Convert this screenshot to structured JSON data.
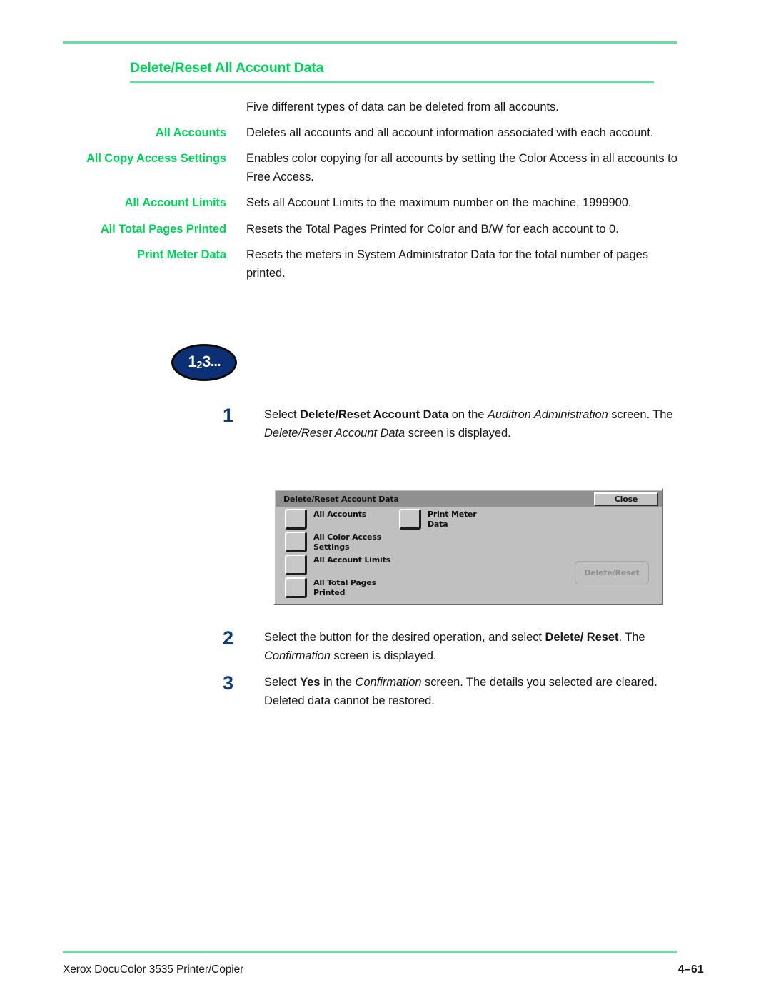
{
  "colors": {
    "heading_green": "#00d357",
    "rule_green": "#5fe39a",
    "step_number_blue": "#10387c",
    "badge_navy": "#0d2f73",
    "device_grey": "#c0c0c0",
    "titlebar_grey": "#909090",
    "disabled_text_grey": "#8f8f8f"
  },
  "heading": "Delete/Reset All Account Data",
  "intro": "Five different types of data can be deleted from all accounts.",
  "definitions": [
    {
      "term": "All Accounts",
      "description": "Deletes all accounts and all account information associated with each account."
    },
    {
      "term": "All Copy Access Settings",
      "description": "Enables color copying for all accounts by setting the Color Access in all accounts to Free Access."
    },
    {
      "term": "All Account Limits",
      "description": "Sets all Account Limits to the maximum number on the machine, 1999900."
    },
    {
      "term": "All Total Pages Printed",
      "description": "Resets the Total Pages Printed for Color and B/W for each account to 0."
    },
    {
      "term": "Print Meter Data",
      "description": "Resets the meters in System Administrator Data for the total number of pages printed."
    }
  ],
  "badge": {
    "digit1": "1",
    "digit2": "2",
    "digit3": "3",
    "dots": "..."
  },
  "steps": [
    {
      "number": "1",
      "text": "Select Delete/Reset Account Data on the Auditron Administration screen. The Delete/Reset Account Data screen is displayed."
    },
    {
      "number": "2",
      "text": "Select the button for the desired operation, and select Delete/ Reset. The Confirmation screen is displayed."
    },
    {
      "number": "3",
      "text": "Select Yes in the Confirmation screen. The details you selected are cleared. Deleted data cannot be restored."
    }
  ],
  "device_screen": {
    "title": "Delete/Reset Account Data",
    "close_label": "Close",
    "options": [
      {
        "label": "All Accounts"
      },
      {
        "label": "All Color Access\nSettings"
      },
      {
        "label": "All Account Limits"
      },
      {
        "label": "All Total Pages\nPrinted"
      },
      {
        "label": "Print Meter\nData"
      }
    ],
    "action_label": "Delete/Reset"
  },
  "footer": {
    "left": "Xerox DocuColor 3535 Printer/Copier",
    "page": "4–61"
  }
}
